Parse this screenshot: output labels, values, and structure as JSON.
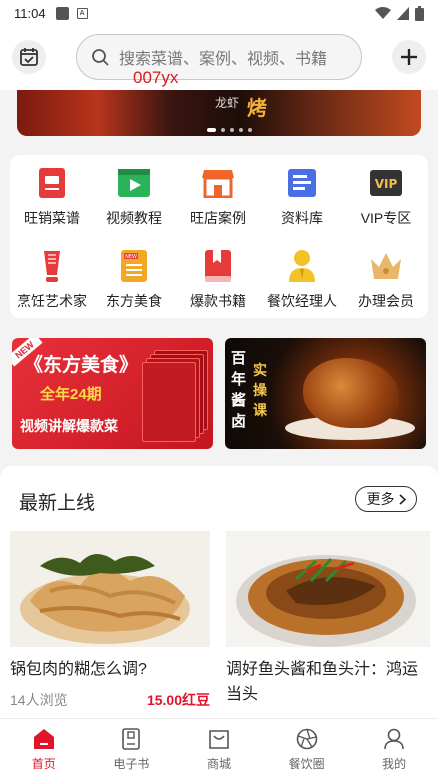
{
  "status_bar": {
    "time": "11:04"
  },
  "header": {
    "search_placeholder": "搜索菜谱、案例、视频、书籍",
    "overlay_tag": "007yx"
  },
  "banner": {
    "text_main": "烤",
    "text_side": "龙虾",
    "slides": 5,
    "active_slide": 0
  },
  "grid": [
    {
      "label": "旺销菜谱",
      "icon": "book-icon",
      "color": "#e63b3b"
    },
    {
      "label": "视频教程",
      "icon": "video-icon",
      "color": "#2bb35a"
    },
    {
      "label": "旺店案例",
      "icon": "store-icon",
      "color": "#f0662a"
    },
    {
      "label": "资料库",
      "icon": "folder-icon",
      "color": "#4a6fe3"
    },
    {
      "label": "VIP专区",
      "icon": "vip-icon",
      "color": "#333333"
    },
    {
      "label": "烹饪艺术家",
      "icon": "chef-knife-icon",
      "color": "#e63b3b"
    },
    {
      "label": "东方美食",
      "icon": "magazine-icon",
      "color": "#f2a825"
    },
    {
      "label": "爆款书籍",
      "icon": "bookmark-book-icon",
      "color": "#e63b3b"
    },
    {
      "label": "餐饮经理人",
      "icon": "manager-icon",
      "color": "#f2c228"
    },
    {
      "label": "办理会员",
      "icon": "crown-icon",
      "color": "#e9b66a"
    }
  ],
  "promo_left": {
    "new_tag": "NEW",
    "title": "《东方美食》",
    "subtitle": "全年24期",
    "bottom": "视频讲解爆款菜"
  },
  "promo_right": {
    "vertical_text": "百年酱卤",
    "stamp_text": "实操课"
  },
  "latest": {
    "title": "最新上线",
    "more_label": "更多",
    "cards": [
      {
        "title": "锅包肉的糊怎么调?",
        "views": "14人浏览",
        "price": "15.00红豆"
      },
      {
        "title": "调好鱼头酱和鱼头汁：鸿运当头",
        "views": "",
        "price": ""
      }
    ]
  },
  "nav": [
    {
      "label": "首页",
      "icon": "home-icon",
      "active": true
    },
    {
      "label": "电子书",
      "icon": "ebook-icon",
      "active": false
    },
    {
      "label": "商城",
      "icon": "shop-bag-icon",
      "active": false
    },
    {
      "label": "餐饮圈",
      "icon": "aperture-icon",
      "active": false
    },
    {
      "label": "我的",
      "icon": "profile-icon",
      "active": false
    }
  ],
  "colors": {
    "accent": "#e0142a",
    "promo_red": "#e1282e"
  }
}
